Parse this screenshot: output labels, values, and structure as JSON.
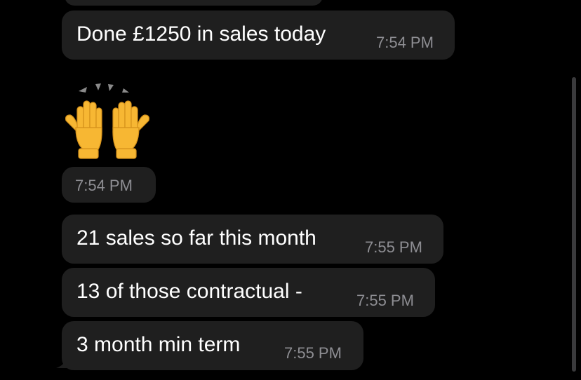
{
  "messages": [
    {
      "text": "Done £1250 in sales today",
      "time": "7:54 PM"
    },
    {
      "emoji": "raising-hands-emoji",
      "time": "7:54 PM"
    },
    {
      "text": "21 sales so far this month",
      "time": "7:55 PM"
    },
    {
      "text": "13 of those contractual -",
      "time": "7:55 PM"
    },
    {
      "text": "3 month min term",
      "time": "7:55 PM"
    }
  ],
  "colors": {
    "background": "#000000",
    "bubble": "#1f1f1f",
    "timestamp": "#8e8e93",
    "text": "#ffffff",
    "scrollbar": "#3a3a3c"
  }
}
